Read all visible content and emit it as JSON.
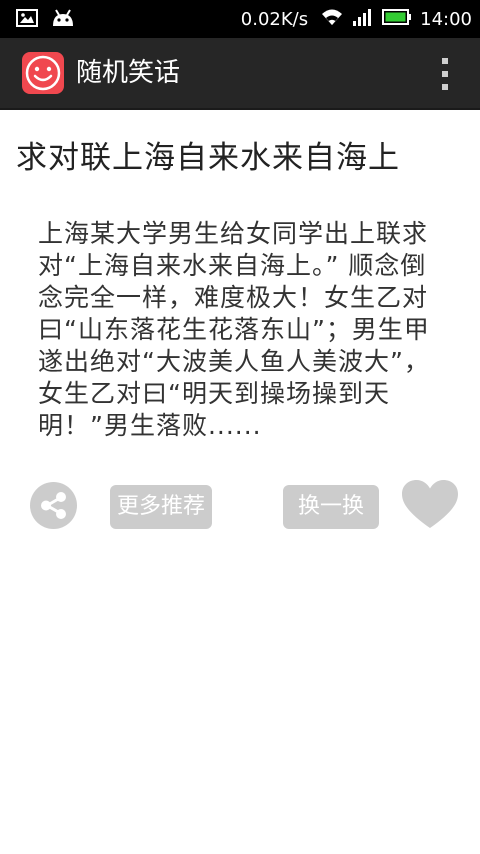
{
  "status_bar": {
    "network_speed": "0.02K/s",
    "time": "14:00",
    "icons": [
      "image-notification-icon",
      "android-notification-icon",
      "wifi-icon",
      "signal-icon",
      "battery-icon"
    ]
  },
  "app_bar": {
    "title": "随机笑话",
    "icon": "smiley-app-icon",
    "menu_icon": "overflow-menu-icon"
  },
  "joke": {
    "title": "求对联上海自来水来自海上",
    "body": "上海某大学男生给女同学出上联求对“上海自来水来自海上。” 顺念倒念完全一样，难度极大！女生乙对曰“山东落花生花落东山”；男生甲遂出绝对“大波美人鱼人美波大”，女生乙对曰“明天到操场操到天明！”男生落败......"
  },
  "actions": {
    "share_icon": "share-icon",
    "more_label": "更多推荐",
    "next_label": "换一换",
    "like_icon": "heart-icon"
  },
  "colors": {
    "status_bar": "#000000",
    "action_bar": "#262626",
    "app_icon": "#f0484f",
    "button_gray": "#cccccc",
    "battery_green": "#33cc33"
  }
}
